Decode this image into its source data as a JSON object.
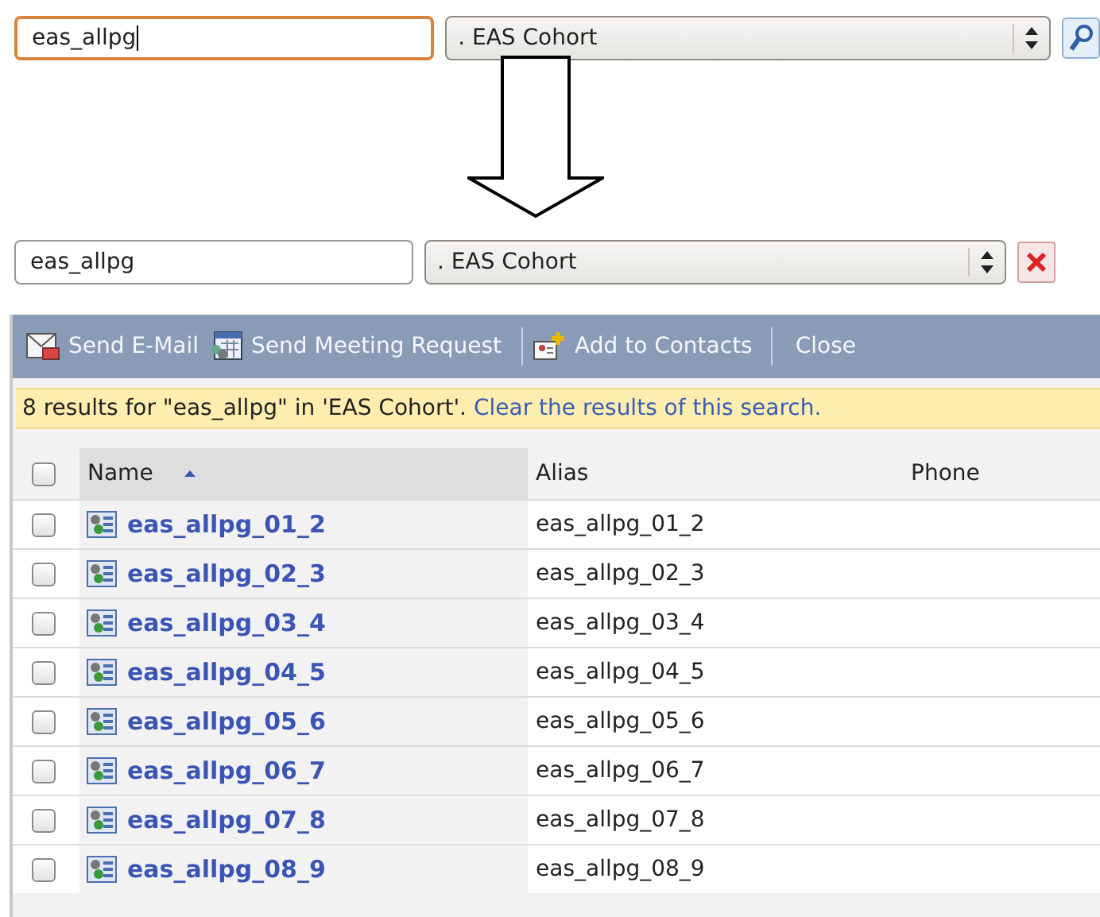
{
  "search_before": {
    "value": "eas_allpg",
    "focused": true
  },
  "scope_before": {
    "value": ". EAS Cohort"
  },
  "search_after": {
    "value": "eas_allpg",
    "focused": false
  },
  "scope_after": {
    "value": ". EAS Cohort"
  },
  "toolbar": [
    {
      "kind": "email",
      "label": "Send E-Mail"
    },
    {
      "kind": "meeting",
      "label": "Send Meeting Request"
    },
    {
      "kind": "separator"
    },
    {
      "kind": "contact",
      "label": "Add to Contacts"
    },
    {
      "kind": "separator"
    },
    {
      "kind": "plain",
      "label": "Close"
    }
  ],
  "results_message": {
    "text": "8 results for \"eas_allpg\" in 'EAS Cohort'.",
    "link": "Clear the results of this search."
  },
  "table": {
    "select_all_checked": false,
    "columns": [
      {
        "label": "Name",
        "sorted": true
      },
      {
        "label": "Alias",
        "sorted": false
      },
      {
        "label": "Phone",
        "sorted": false
      }
    ],
    "rows": [
      {
        "name": "eas_allpg_01_2",
        "alias": "eas_allpg_01_2",
        "checked": false
      },
      {
        "name": "eas_allpg_02_3",
        "alias": "eas_allpg_02_3",
        "checked": false
      },
      {
        "name": "eas_allpg_03_4",
        "alias": "eas_allpg_03_4",
        "checked": false
      },
      {
        "name": "eas_allpg_04_5",
        "alias": "eas_allpg_04_5",
        "checked": false
      },
      {
        "name": "eas_allpg_05_6",
        "alias": "eas_allpg_05_6",
        "checked": false
      },
      {
        "name": "eas_allpg_06_7",
        "alias": "eas_allpg_06_7",
        "checked": false
      },
      {
        "name": "eas_allpg_07_8",
        "alias": "eas_allpg_07_8",
        "checked": false
      },
      {
        "name": "eas_allpg_08_9",
        "alias": "eas_allpg_08_9",
        "checked": false
      }
    ]
  }
}
